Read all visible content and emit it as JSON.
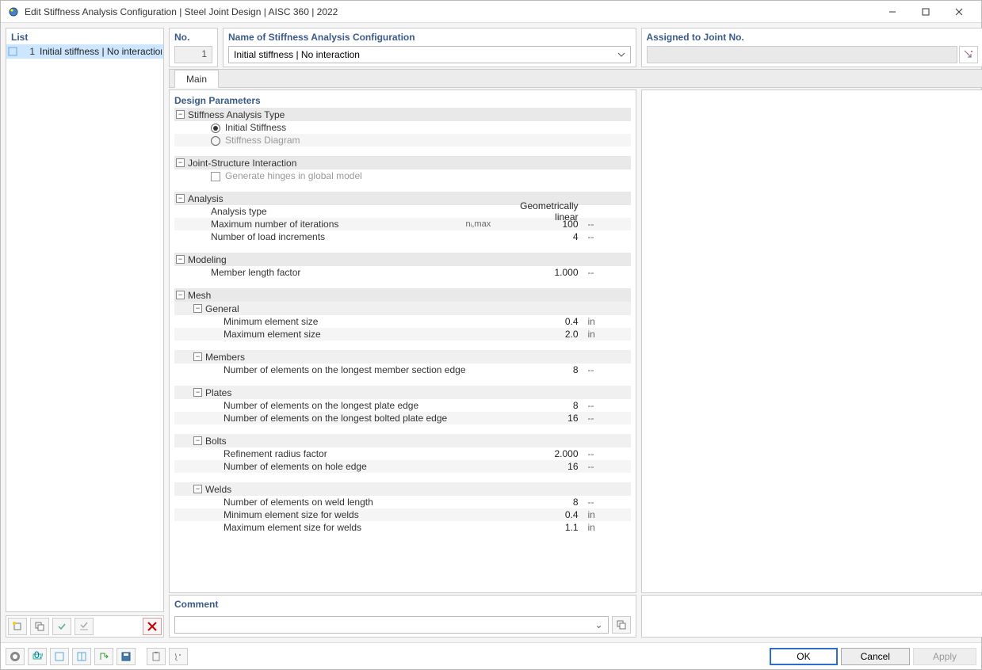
{
  "window": {
    "title": "Edit Stiffness Analysis Configuration | Steel Joint Design | AISC 360 | 2022"
  },
  "header": {
    "no_label": "No.",
    "no_value": "1",
    "name_label": "Name of Stiffness Analysis Configuration",
    "name_value": "Initial stiffness | No interaction",
    "assign_label": "Assigned to Joint No.",
    "assign_value": ""
  },
  "sidebar": {
    "list_label": "List",
    "items": [
      {
        "num": "1",
        "label": "Initial stiffness | No interaction"
      }
    ]
  },
  "tabs": {
    "main": "Main"
  },
  "params": {
    "heading": "Design Parameters",
    "stiffness_type": {
      "group": "Stiffness Analysis Type",
      "opt_initial": "Initial Stiffness",
      "opt_diagram": "Stiffness Diagram"
    },
    "joint_struct": {
      "group": "Joint-Structure Interaction",
      "generate_hinges": "Generate hinges in global model"
    },
    "analysis": {
      "group": "Analysis",
      "type_label": "Analysis type",
      "type_value": "Geometrically linear",
      "max_iter_label": "Maximum number of iterations",
      "max_iter_sym": "nᵢ,max",
      "max_iter_val": "100",
      "max_iter_unit": "--",
      "incr_label": "Number of load increments",
      "incr_val": "4",
      "incr_unit": "--"
    },
    "modeling": {
      "group": "Modeling",
      "mlf_label": "Member length factor",
      "mlf_val": "1.000",
      "mlf_unit": "--"
    },
    "mesh": {
      "group": "Mesh",
      "general": {
        "sub": "General",
        "min_label": "Minimum element size",
        "min_val": "0.4",
        "min_unit": "in",
        "max_label": "Maximum element size",
        "max_val": "2.0",
        "max_unit": "in"
      },
      "members": {
        "sub": "Members",
        "n_label": "Number of elements on the longest member section edge",
        "n_val": "8",
        "n_unit": "--"
      },
      "plates": {
        "sub": "Plates",
        "p1_label": "Number of elements on the longest plate edge",
        "p1_val": "8",
        "p1_unit": "--",
        "p2_label": "Number of elements on the longest bolted plate edge",
        "p2_val": "16",
        "p2_unit": "--"
      },
      "bolts": {
        "sub": "Bolts",
        "r_label": "Refinement radius factor",
        "r_val": "2.000",
        "r_unit": "--",
        "h_label": "Number of elements on hole edge",
        "h_val": "16",
        "h_unit": "--"
      },
      "welds": {
        "sub": "Welds",
        "w1_label": "Number of elements on weld length",
        "w1_val": "8",
        "w1_unit": "--",
        "w2_label": "Minimum element size for welds",
        "w2_val": "0.4",
        "w2_unit": "in",
        "w3_label": "Maximum element size for welds",
        "w3_val": "1.1",
        "w3_unit": "in"
      }
    }
  },
  "comment": {
    "label": "Comment",
    "value": ""
  },
  "footer": {
    "ok": "OK",
    "cancel": "Cancel",
    "apply": "Apply"
  }
}
